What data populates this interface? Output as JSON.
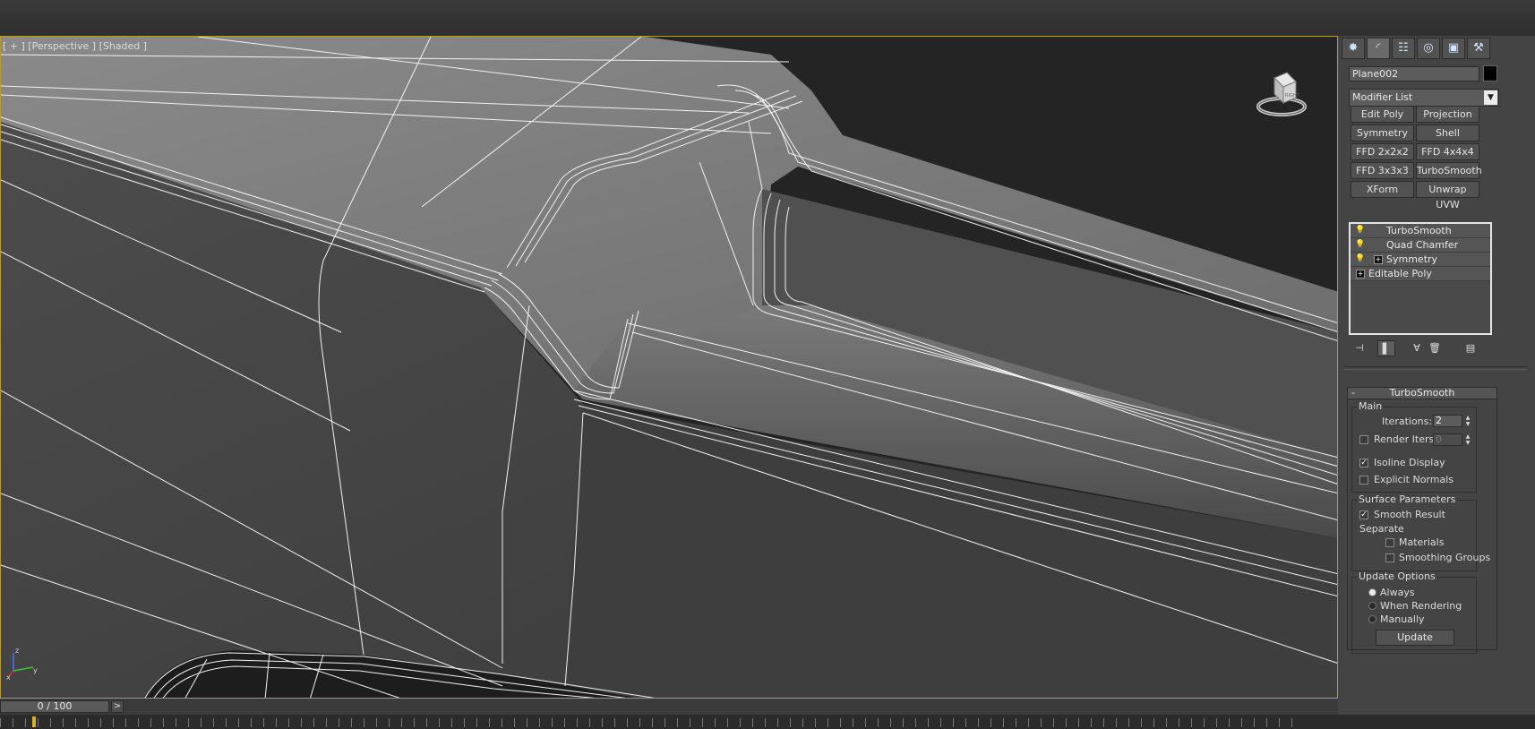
{
  "viewport": {
    "label": "[ + ] [Perspective ] [Shaded ]",
    "viewcube_face": "RIGHT"
  },
  "axis": {
    "z_label": "z",
    "x_label": "x",
    "y_label": "y"
  },
  "timeline": {
    "slider_text": "0 / 100",
    "next_symbol": ">"
  },
  "panel": {
    "tabs": [
      {
        "name": "create",
        "glyph": "✸"
      },
      {
        "name": "modify",
        "glyph": "◜"
      },
      {
        "name": "hierarchy",
        "glyph": "☷"
      },
      {
        "name": "motion",
        "glyph": "◎"
      },
      {
        "name": "display",
        "glyph": "▣"
      },
      {
        "name": "utilities",
        "glyph": "⚒"
      }
    ],
    "object_name": "Plane002",
    "object_color": "#000000",
    "modifier_list": "Modifier List",
    "modifier_buttons": [
      "Edit Poly",
      "Projection",
      "Symmetry",
      "Shell",
      "FFD 2x2x2",
      "FFD 4x4x4",
      "FFD 3x3x3",
      "TurboSmooth",
      "XForm",
      "Unwrap UVW"
    ],
    "stack": [
      {
        "label": "TurboSmooth",
        "bulb": true,
        "plus": false
      },
      {
        "label": "Quad Chamfer",
        "bulb": true,
        "plus": false
      },
      {
        "label": "Symmetry",
        "bulb": true,
        "plus": true
      },
      {
        "label": "Editable Poly",
        "bulb": false,
        "plus": true
      }
    ]
  },
  "turbosmooth": {
    "title": "TurboSmooth",
    "main": {
      "title": "Main",
      "iterations_label": "Iterations:",
      "iterations_value": "2",
      "render_iters_label": "Render Iters:",
      "render_iters_value": "0",
      "render_iters_checked": false,
      "isoline_label": "Isoline Display",
      "isoline_checked": true,
      "explicit_normals_label": "Explicit Normals",
      "explicit_normals_checked": false
    },
    "surface": {
      "title": "Surface Parameters",
      "smooth_result_label": "Smooth Result",
      "smooth_result_checked": true,
      "separate_label": "Separate",
      "materials_label": "Materials",
      "smoothing_groups_label": "Smoothing Groups"
    },
    "update": {
      "title": "Update Options",
      "always_label": "Always",
      "when_rendering_label": "When Rendering",
      "manually_label": "Manually",
      "selected": "Always",
      "update_button": "Update"
    }
  }
}
